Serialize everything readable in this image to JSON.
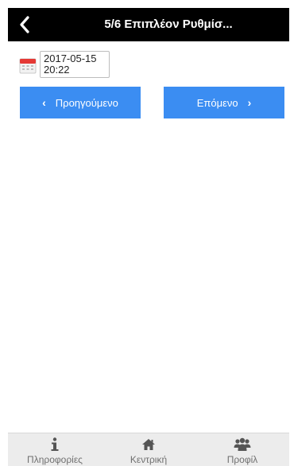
{
  "header": {
    "title": "5/6 Επιπλέον Ρυθμίσ...",
    "back_icon": "chevron-left-icon"
  },
  "datetime": {
    "icon": "calendar-icon",
    "date": "2017-05-15",
    "time": "20:22"
  },
  "navigation": {
    "prev_label": "Προηγούμενο",
    "next_label": "Επόμενο",
    "prev_chevron": "‹",
    "next_chevron": "›",
    "button_color": "#3b8df2"
  },
  "bottom_nav": {
    "tabs": [
      {
        "label": "Πληροφορίες",
        "icon": "info-icon"
      },
      {
        "label": "Κεντρική",
        "icon": "home-icon"
      },
      {
        "label": "Προφίλ",
        "icon": "users-icon"
      }
    ]
  }
}
